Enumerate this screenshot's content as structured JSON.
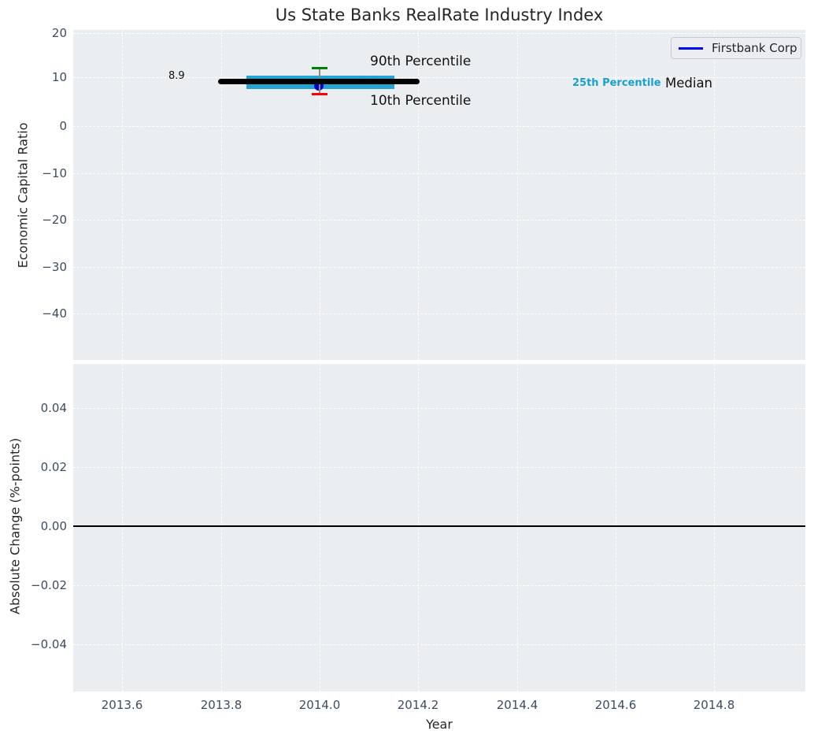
{
  "title": "Us State Banks RealRate Industry Index",
  "legend": {
    "firstbank_label": "Firstbank Corp"
  },
  "annotations": {
    "median_value": "8.9",
    "p90": "90th Percentile",
    "p10": "10th Percentile",
    "p25": "25th Percentile",
    "median": "Median"
  },
  "axes": {
    "top": {
      "ylabel": "Economic Capital Ratio",
      "yticks": [
        "20",
        "10",
        "0",
        "−10",
        "−20",
        "−30",
        "−40"
      ]
    },
    "bottom": {
      "ylabel": "Absolute Change (%-points)",
      "yticks": [
        "0.04",
        "0.02",
        "0.00",
        "−0.02",
        "−0.04"
      ]
    },
    "x": {
      "label": "Year",
      "ticks": [
        "2013.6",
        "2013.8",
        "2014.0",
        "2014.2",
        "2014.4",
        "2014.6",
        "2014.8"
      ]
    }
  },
  "colors": {
    "plot_background": "#ebeef0",
    "gridline": "#ffffff",
    "median_line": "#000000",
    "percentile_band": "#149dce",
    "percentile_90_cap": "#008002",
    "percentile_10_cap": "#ff0000",
    "company_marker": "#0000cc",
    "legend_line": "#0000f0",
    "p25_text": "#1a9fd4",
    "tick_text": "#3d4c5f"
  },
  "chart_data": [
    {
      "type": "line",
      "title": "Us State Banks RealRate Industry Index",
      "xlabel": "Year",
      "ylabel": "Economic Capital Ratio",
      "xlim": [
        2013.5,
        2014.98
      ],
      "ylim": [
        -50,
        20.7
      ],
      "x_ticks": [
        2013.6,
        2013.8,
        2014.0,
        2014.2,
        2014.4,
        2014.6,
        2014.8
      ],
      "y_ticks": [
        20,
        10,
        0,
        -10,
        -20,
        -30,
        -40
      ],
      "grid": true,
      "legend_position": "upper right",
      "series": [
        {
          "name": "Firstbank Corp",
          "type": "scatter",
          "x": [
            2014.0
          ],
          "y": [
            8.5
          ],
          "color": "#0000cc",
          "marker": "circle"
        },
        {
          "name": "Median",
          "type": "line",
          "x": [
            2013.8,
            2014.2
          ],
          "y": [
            8.9,
            8.9
          ],
          "color": "#000000",
          "linewidth": 7
        },
        {
          "name": "25th-75th Percentile band",
          "type": "band",
          "x": [
            2013.85,
            2014.15
          ],
          "y_low": 7.9,
          "y_high": 10.2,
          "color": "#149dce"
        },
        {
          "name": "90th Percentile",
          "type": "errorbar_cap",
          "x": [
            2014.0
          ],
          "y": [
            12.2
          ],
          "color": "#008002"
        },
        {
          "name": "10th Percentile",
          "type": "errorbar_cap",
          "x": [
            2014.0
          ],
          "y": [
            6.8
          ],
          "color": "#ff0000"
        }
      ],
      "annotations": [
        {
          "text": "8.9",
          "x": 2013.71,
          "y": 10.6
        },
        {
          "text": "90th Percentile",
          "x": 2014.1,
          "y": 13.8
        },
        {
          "text": "10th Percentile",
          "x": 2014.1,
          "y": 5.4
        },
        {
          "text": "25th Percentile",
          "x": 2014.51,
          "y": 8.9,
          "color": "#1a9fd4"
        },
        {
          "text": "Median",
          "x": 2014.7,
          "y": 8.9
        }
      ]
    },
    {
      "type": "line",
      "xlabel": "Year",
      "ylabel": "Absolute Change (%-points)",
      "xlim": [
        2013.5,
        2014.98
      ],
      "ylim": [
        -0.056,
        0.055
      ],
      "x_ticks": [
        2013.6,
        2013.8,
        2014.0,
        2014.2,
        2014.4,
        2014.6,
        2014.8
      ],
      "y_ticks": [
        0.04,
        0.02,
        0.0,
        -0.02,
        -0.04
      ],
      "grid": true,
      "series": [
        {
          "name": "zero line",
          "type": "hline",
          "y": 0.0,
          "color": "#000000",
          "linewidth": 2
        }
      ]
    }
  ]
}
